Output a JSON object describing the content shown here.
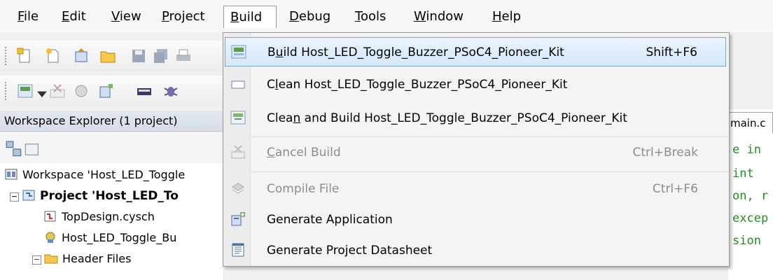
{
  "menubar": {
    "items": [
      {
        "pre": "",
        "u": "F",
        "post": "ile"
      },
      {
        "pre": "",
        "u": "E",
        "post": "dit"
      },
      {
        "pre": "",
        "u": "V",
        "post": "iew"
      },
      {
        "pre": "",
        "u": "P",
        "post": "roject"
      },
      {
        "pre": "",
        "u": "B",
        "post": "uild"
      },
      {
        "pre": "",
        "u": "D",
        "post": "ebug"
      },
      {
        "pre": "",
        "u": "T",
        "post": "ools"
      },
      {
        "pre": "",
        "u": "W",
        "post": "indow"
      },
      {
        "pre": "",
        "u": "H",
        "post": "elp"
      }
    ],
    "active_index": 4
  },
  "build_menu": {
    "items": [
      {
        "pre": "B",
        "u": "u",
        "post": "ild Host_LED_Toggle_Buzzer_PSoC4_Pioneer_Kit",
        "shortcut": "Shift+F6",
        "icon": "build-icon",
        "enabled": true,
        "highlighted": true
      },
      {
        "pre": "C",
        "u": "l",
        "post": "ean Host_LED_Toggle_Buzzer_PSoC4_Pioneer_Kit",
        "shortcut": "",
        "icon": "clean-icon",
        "enabled": true
      },
      {
        "pre": "Clea",
        "u": "n",
        "post": " and Build Host_LED_Toggle_Buzzer_PSoC4_Pioneer_Kit",
        "shortcut": "",
        "icon": "clean-build-icon",
        "enabled": true
      },
      {
        "pre": "",
        "u": "C",
        "post": "ancel Build",
        "shortcut": "Ctrl+Break",
        "icon": "cancel-build-icon",
        "enabled": false
      },
      {
        "pre": "Compile File",
        "u": "",
        "post": "",
        "shortcut": "Ctrl+F6",
        "icon": "compile-file-icon",
        "enabled": false
      },
      {
        "pre": "Generate Application",
        "u": "",
        "post": "",
        "shortcut": "",
        "icon": "generate-application-icon",
        "enabled": true
      },
      {
        "pre": "Generate Project Datasheet",
        "u": "",
        "post": "",
        "shortcut": "",
        "icon": "datasheet-icon",
        "enabled": true
      }
    ]
  },
  "workspace": {
    "title": "Workspace Explorer (1 project)",
    "tree": [
      {
        "label": "Workspace 'Host_LED_Toggle",
        "icon": "workspace-icon"
      },
      {
        "label": "Project 'Host_LED_To",
        "icon": "project-icon",
        "expander": "−"
      },
      {
        "label": "TopDesign.cysch",
        "icon": "schematic-icon"
      },
      {
        "label": "Host_LED_Toggle_Bu",
        "icon": "cydwr-icon"
      },
      {
        "label": "Header Files",
        "icon": "folder-icon",
        "expander": "−"
      }
    ]
  },
  "editor": {
    "tab_label": "main.c",
    "code_lines": [
      "e in",
      " int",
      "on, r",
      "excep",
      "sion"
    ]
  },
  "colors": {
    "highlight_border": "#7da2ce",
    "code_comment": "#2a8a2a"
  }
}
